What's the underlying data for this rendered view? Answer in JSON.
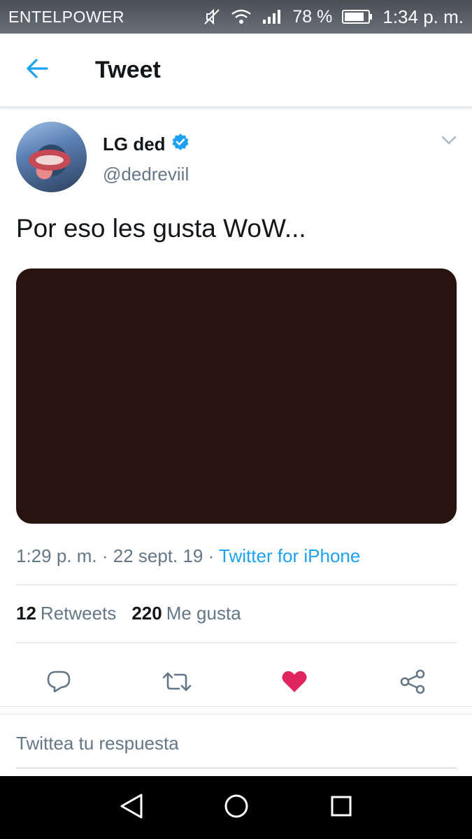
{
  "status_bar": {
    "carrier": "ENTELPOWER",
    "battery": "78 %",
    "time": "1:34 p. m."
  },
  "header": {
    "title": "Tweet",
    "icons": {
      "back": "arrow-left-icon"
    }
  },
  "tweet": {
    "display_name": "LG ded",
    "username": "@dedreviil",
    "verified": true,
    "text": "Por eso les gusta WoW...",
    "time": "1:29 p. m.",
    "date": "22 sept. 19",
    "separator": " · ",
    "source": "Twitter for iPhone",
    "media_color": "#27140f"
  },
  "stats": {
    "retweets_count": "12",
    "retweets_label": "Retweets",
    "likes_count": "220",
    "likes_label": "Me gusta"
  },
  "actions": {
    "icons": [
      "reply-icon",
      "retweet-icon",
      "like-icon",
      "share-icon"
    ],
    "liked": true,
    "like_color": "#e0245e"
  },
  "reply": {
    "placeholder": "Twittea tu respuesta"
  },
  "nav_bar": {
    "icons": [
      "nav-back-icon",
      "nav-home-icon",
      "nav-recents-icon"
    ]
  },
  "colors": {
    "accent": "#1da1f2",
    "secondary_text": "#657786",
    "primary_text": "#14171a"
  }
}
